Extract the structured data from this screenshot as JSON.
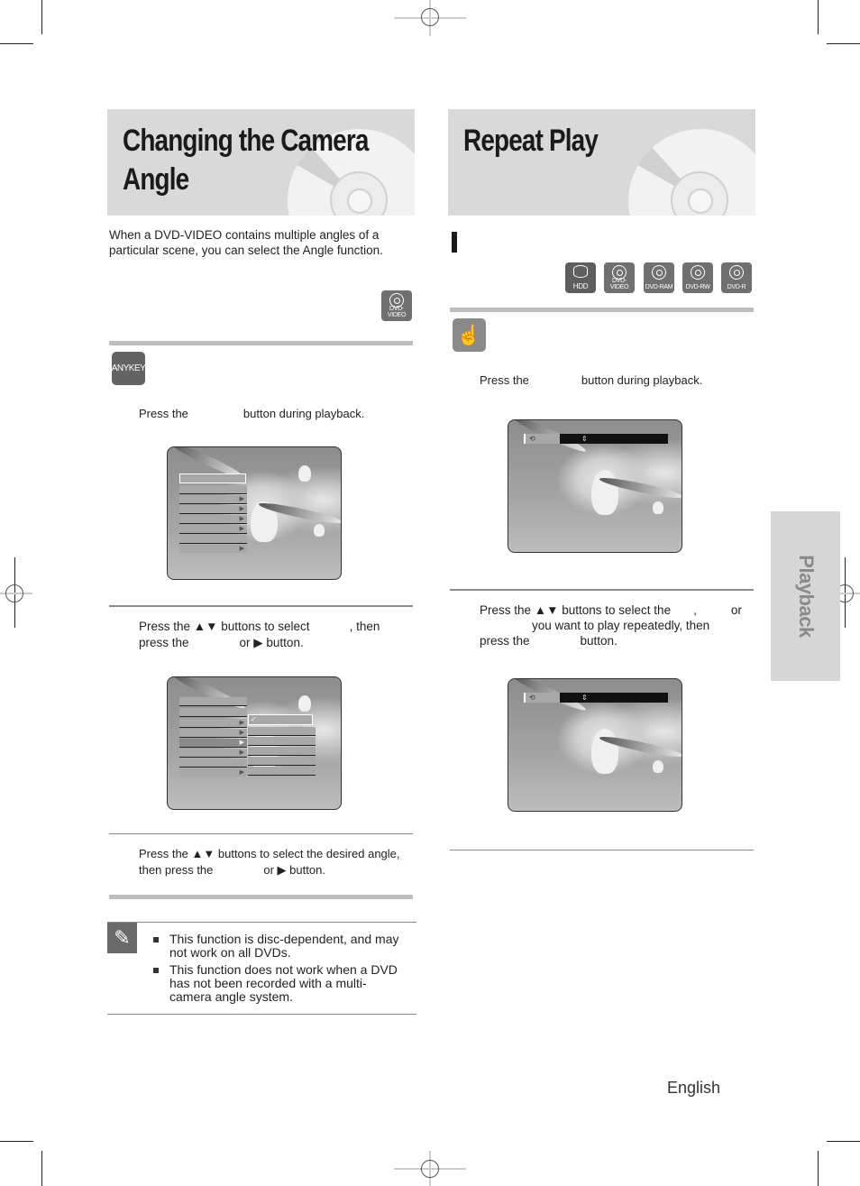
{
  "left": {
    "title_line1": "Changing the Camera",
    "title_line2": "Angle",
    "intro_line1": "When a DVD-VIDEO contains multiple angles of a",
    "intro_line2": "particular scene, you can select the Angle function.",
    "disc_badge": "DVD-VIDEO",
    "method_icon": "ANYKEY",
    "step1": {
      "part1": "Press the",
      "part2": "button during playback."
    },
    "step2": {
      "line1_a": "Press the ▲▼ buttons to select",
      "line1_b": ", then",
      "line2_a": "press the",
      "line2_b": "or ▶ button."
    },
    "step3": {
      "line1": "Press the ▲▼ buttons to select the desired angle,",
      "line2_a": "then press the",
      "line2_b": "or ▶ button."
    },
    "notes": [
      {
        "line1": "This function is disc-dependent, and may",
        "line2": "not work on all DVDs."
      },
      {
        "line1": "This function does not work when a DVD",
        "line2": "has not been recorded with a multi-",
        "line3": "camera angle system."
      }
    ],
    "screen2_check": "✓"
  },
  "right": {
    "title": "Repeat Play",
    "disc_badges": [
      "HDD",
      "DVD-VIDEO",
      "DVD-RAM",
      "DVD-RW",
      "DVD-R"
    ],
    "step1": {
      "part1": "Press the",
      "part2": "button during playback."
    },
    "step2": {
      "line1_a": "Press the ▲▼ buttons to select the",
      "line1_b": ",",
      "line1_c": "or",
      "line2": "you want to play repeatedly, then",
      "line3_a": "press the",
      "line3_b": "button."
    },
    "osd_icon": "repeat-icon",
    "osd_updown": "⇕"
  },
  "side_tab": "Playback",
  "footer": {
    "language": "English"
  }
}
